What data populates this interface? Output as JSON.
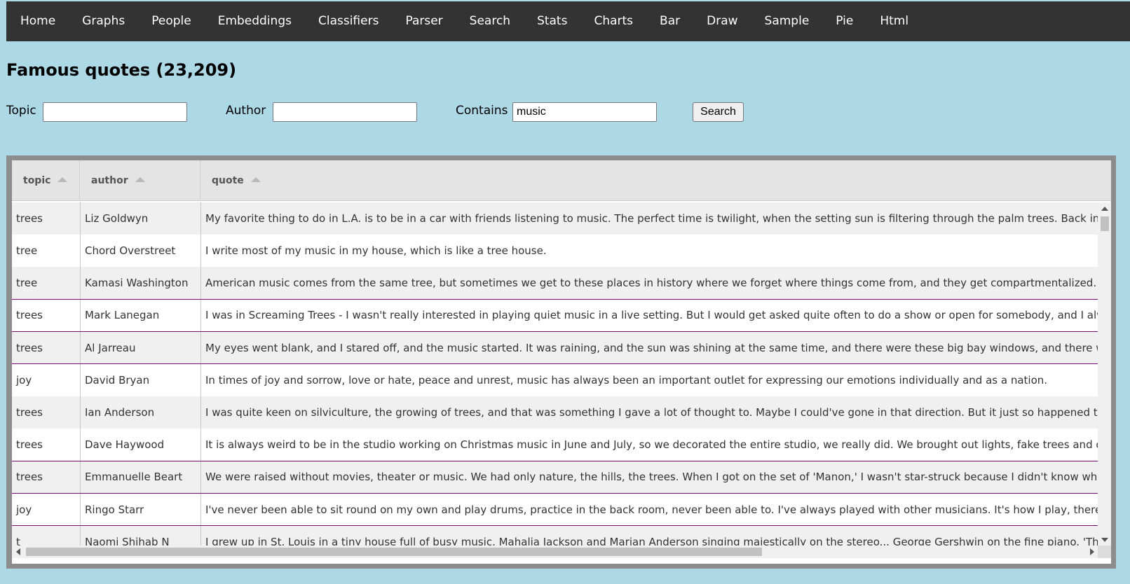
{
  "nav": {
    "items": [
      "Home",
      "Graphs",
      "People",
      "Embeddings",
      "Classifiers",
      "Parser",
      "Search",
      "Stats",
      "Charts",
      "Bar",
      "Draw",
      "Sample",
      "Pie",
      "Html"
    ]
  },
  "page": {
    "title": "Famous quotes (23,209)"
  },
  "search": {
    "topic_label": "Topic",
    "topic_value": "",
    "author_label": "Author",
    "author_value": "",
    "contains_label": "Contains",
    "contains_value": "music",
    "button_label": "Search"
  },
  "table": {
    "columns": [
      "topic",
      "author",
      "quote"
    ],
    "rows": [
      {
        "topic": "trees",
        "author": "Liz Goldwyn",
        "quote": "My favorite thing to do in L.A. is to be in a car with friends listening to music. The perfect time is twilight, when the setting sun is filtering through the palm trees. Back in the day, w"
      },
      {
        "topic": "tree",
        "author": "Chord Overstreet",
        "quote": "I write most of my music in my house, which is like a tree house."
      },
      {
        "topic": "tree",
        "author": "Kamasi Washington",
        "quote": "American music comes from the same tree, but sometimes we get to these places in history where we forget where things come from, and they get compartmentalized."
      },
      {
        "topic": "trees",
        "author": "Mark Lanegan",
        "quote": "I was in Screaming Trees - I wasn't really interested in playing quiet music in a live setting. But I would get asked quite often to do a show or open for somebody, and I always said n"
      },
      {
        "topic": "trees",
        "author": "Al Jarreau",
        "quote": "My eyes went blank, and I stared off, and the music started. It was raining, and the sun was shining at the same time, and there were these big bay windows, and there was the blu"
      },
      {
        "topic": "joy",
        "author": "David Bryan",
        "quote": "In times of joy and sorrow, love or hate, peace and unrest, music has always been an important outlet for expressing our emotions individually and as a nation."
      },
      {
        "topic": "trees",
        "author": "Ian Anderson",
        "quote": "I was quite keen on silviculture, the growing of trees, and that was something I gave a lot of thought to. Maybe I could've gone in that direction. But it just so happened that while I"
      },
      {
        "topic": "trees",
        "author": "Dave Haywood",
        "quote": "It is always weird to be in the studio working on Christmas music in June and July, so we decorated the entire studio, we really did. We brought out lights, fake trees and decorated"
      },
      {
        "topic": "trees",
        "author": "Emmanuelle Beart",
        "quote": "We were raised without movies, theater or music. We had only nature, the hills, the trees. When I got on the set of 'Manon,' I wasn't star-struck because I didn't know what a star w"
      },
      {
        "topic": "joy",
        "author": "Ringo Starr",
        "quote": "I've never been able to sit round on my own and play drums, practice in the back room, never been able to. I've always played with other musicians. It's how I play, there's no joy fo"
      },
      {
        "topic": "t",
        "author": "Naomi Shihab N",
        "quote": "I grew up in St. Louis in a tiny house full of busy music. Mahalia Jackson and Marian Anderson singing majestically on the stereo... George Gershwin on the fine piano. 'The Lost"
      }
    ]
  }
}
